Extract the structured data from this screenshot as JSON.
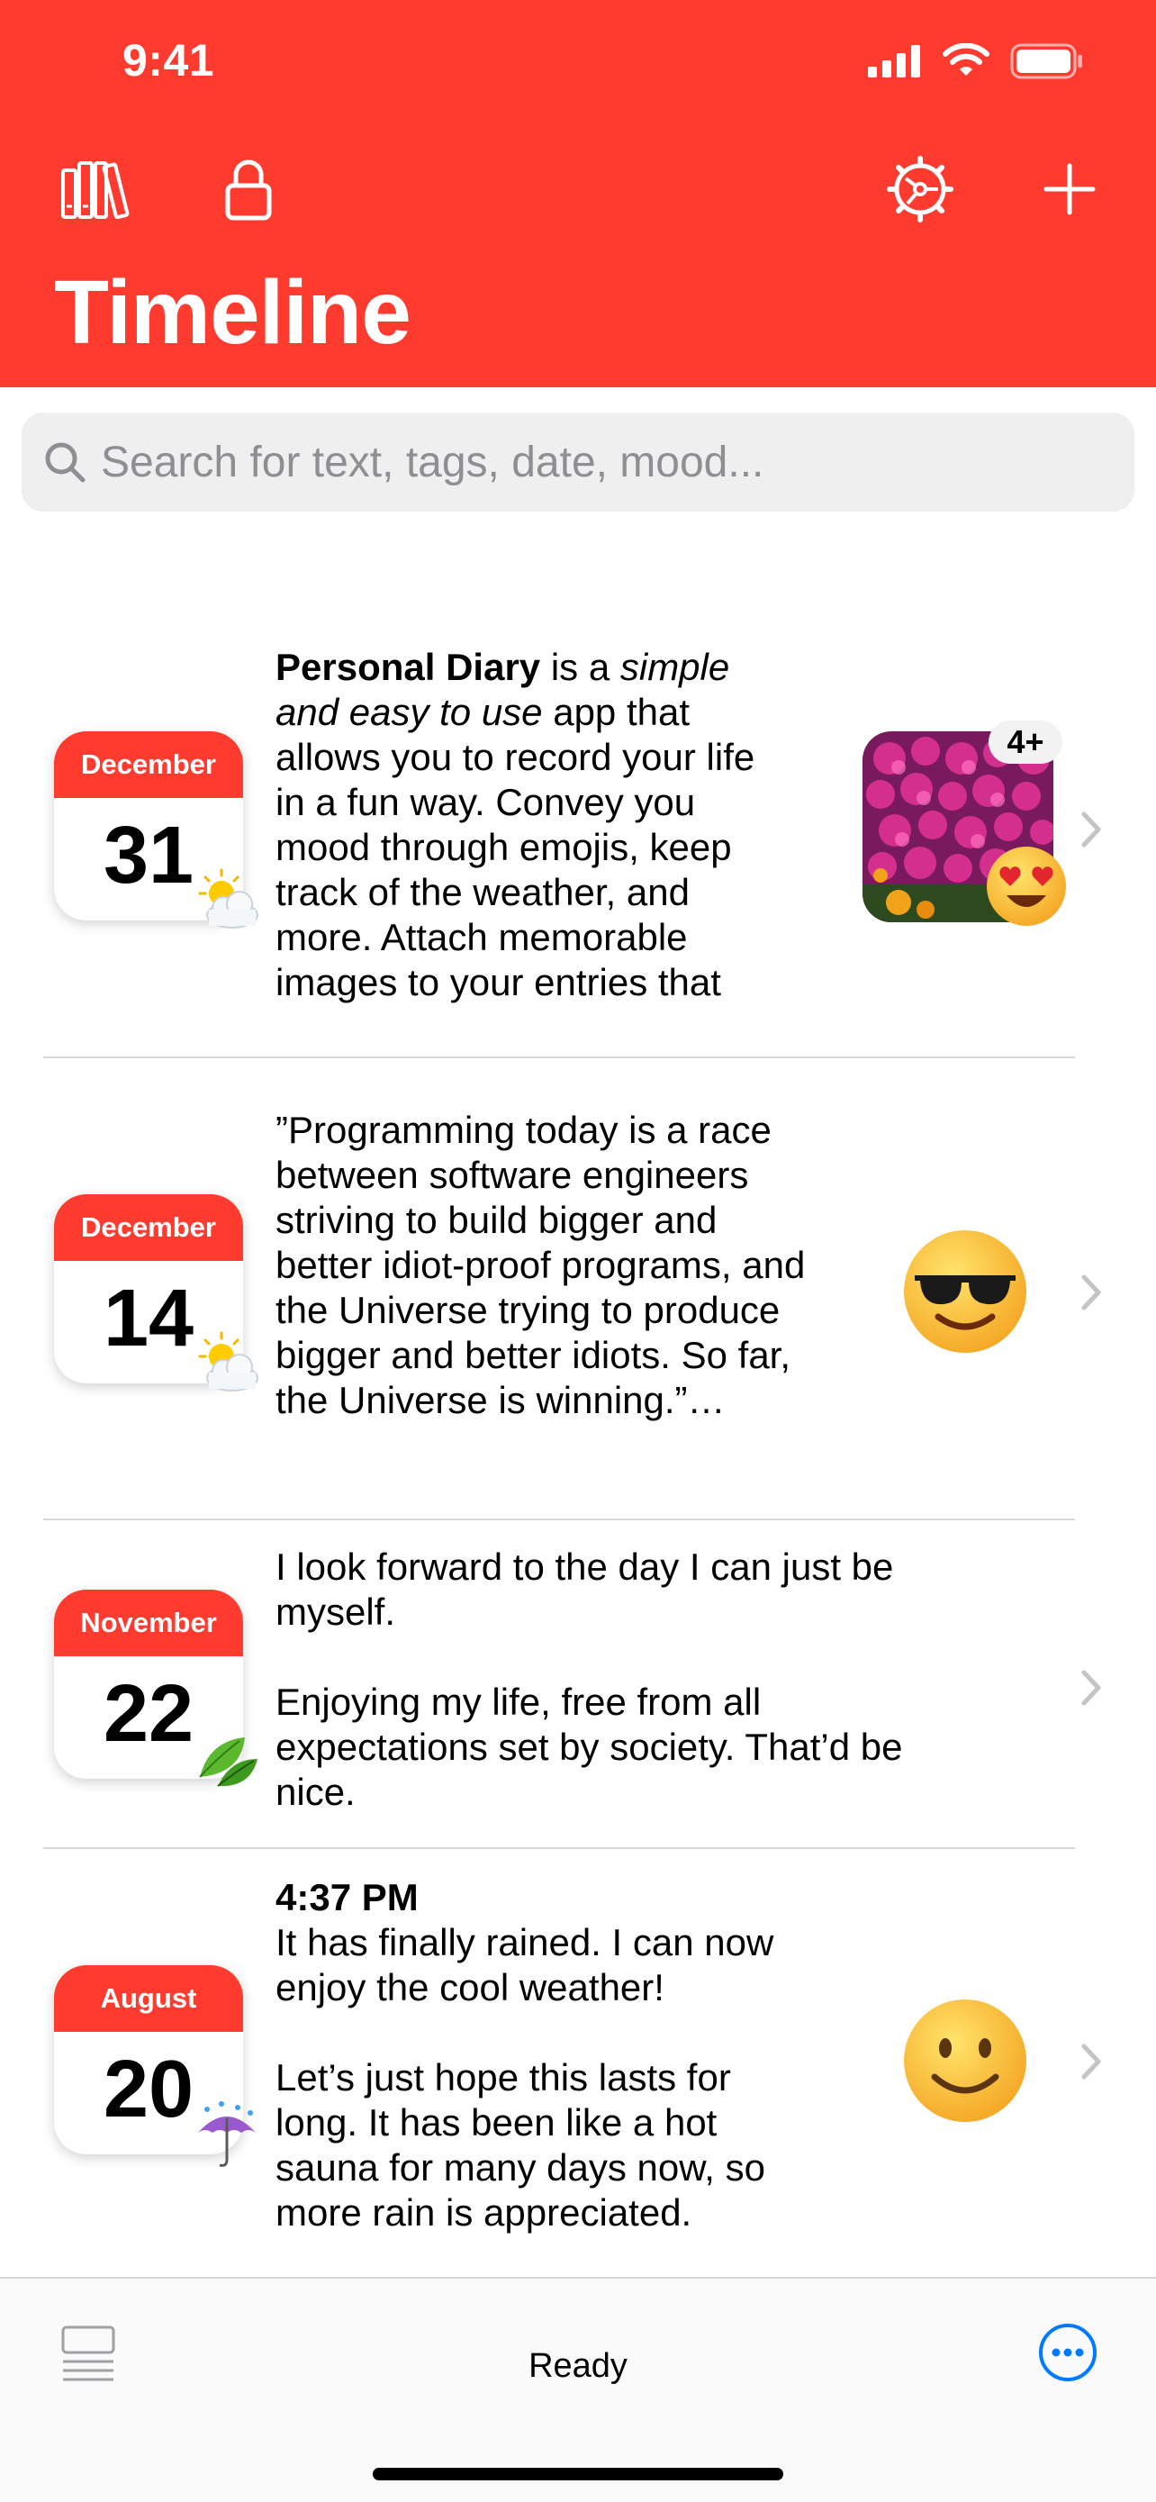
{
  "status_bar": {
    "time": "9:41"
  },
  "header": {
    "title": "Timeline",
    "icons": [
      "library-icon",
      "lock-icon",
      "settings-icon",
      "add-icon"
    ]
  },
  "search": {
    "placeholder": "Search for text, tags, date, mood..."
  },
  "entries": [
    {
      "month": "December",
      "day": "31",
      "weather": "partly-sunny-icon",
      "text_bold": "Personal Diary",
      "text_a": " is a ",
      "text_italic": "simple\nand easy to use",
      "text_b": " app that\nallows you to record your life\nin a fun way. Convey you\nmood through emojis, keep\ntrack of the weather, and\nmore. Attach memorable\nimages to your entries that",
      "photo_badge": "4+",
      "mood": "heart-eyes-emoji"
    },
    {
      "month": "December",
      "day": "14",
      "weather": "partly-sunny-icon",
      "text": "”Programming today is a race\nbetween software engineers\nstriving to build bigger and\nbetter idiot-proof programs, and\nthe Universe trying to produce\nbigger and better idiots. So far,\nthe Universe is winning.”…",
      "mood": "sunglasses-emoji"
    },
    {
      "month": "November",
      "day": "22",
      "weather": "leaf-icon",
      "text": "I look forward to the day I can just be\nmyself.\n\nEnjoying my life, free from all\nexpectations set by society. That’d be\nnice."
    },
    {
      "month": "August",
      "day": "20",
      "weather": "umbrella-rain-icon",
      "time": "4:37 PM",
      "text": "It has finally rained. I can now\nenjoy the cool weather!\n\nLet’s just hope this lasts for\nlong. It has been like a hot\nsauna for many days now, so\nmore rain is appreciated.",
      "mood": "slight-smile-emoji"
    }
  ],
  "bottom_bar": {
    "status": "Ready"
  },
  "colors": {
    "accent": "#ff3b30",
    "link": "#007aff"
  }
}
